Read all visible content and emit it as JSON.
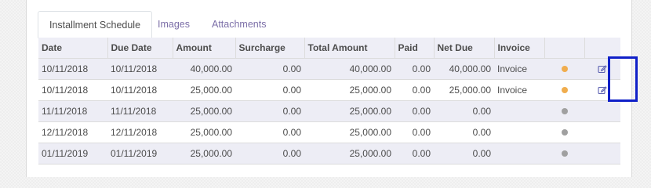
{
  "tabs": [
    {
      "label": "Installment Schedule",
      "active": true
    },
    {
      "label": "Images",
      "active": false
    },
    {
      "label": "Attachments",
      "active": false
    }
  ],
  "table": {
    "columns": [
      "Date",
      "Due Date",
      "Amount",
      "Surcharge",
      "Total Amount",
      "Paid",
      "Net Due",
      "Invoice",
      "",
      ""
    ],
    "rows": [
      {
        "date": "10/11/2018",
        "due_date": "10/11/2018",
        "amount": "40,000.00",
        "surcharge": "0.00",
        "total": "40,000.00",
        "paid": "0.00",
        "net_due": "40,000.00",
        "invoice": "Invoice",
        "status_color": "#f0ad4e",
        "status_icon": "status-dot-icon",
        "has_edit": true
      },
      {
        "date": "10/11/2018",
        "due_date": "10/11/2018",
        "amount": "25,000.00",
        "surcharge": "0.00",
        "total": "25,000.00",
        "paid": "0.00",
        "net_due": "25,000.00",
        "invoice": "Invoice",
        "status_color": "#f0ad4e",
        "status_icon": "status-dot-icon",
        "has_edit": true
      },
      {
        "date": "11/11/2018",
        "due_date": "11/11/2018",
        "amount": "25,000.00",
        "surcharge": "0.00",
        "total": "25,000.00",
        "paid": "0.00",
        "net_due": "0.00",
        "invoice": "",
        "status_color": "#a0a0a0",
        "status_icon": "status-dot-icon",
        "has_edit": false
      },
      {
        "date": "12/11/2018",
        "due_date": "12/11/2018",
        "amount": "25,000.00",
        "surcharge": "0.00",
        "total": "25,000.00",
        "paid": "0.00",
        "net_due": "0.00",
        "invoice": "",
        "status_color": "#a0a0a0",
        "status_icon": "status-dot-icon",
        "has_edit": false
      },
      {
        "date": "01/11/2019",
        "due_date": "01/11/2019",
        "amount": "25,000.00",
        "surcharge": "0.00",
        "total": "25,000.00",
        "paid": "0.00",
        "net_due": "0.00",
        "invoice": "",
        "status_color": "#a0a0a0",
        "status_icon": "status-dot-icon",
        "has_edit": false
      }
    ]
  },
  "colors": {
    "tab_link": "#7c6fa8",
    "highlight_border": "#1020c8",
    "row_stripe": "#ededf5"
  },
  "icons": {
    "edit": "edit-icon"
  }
}
